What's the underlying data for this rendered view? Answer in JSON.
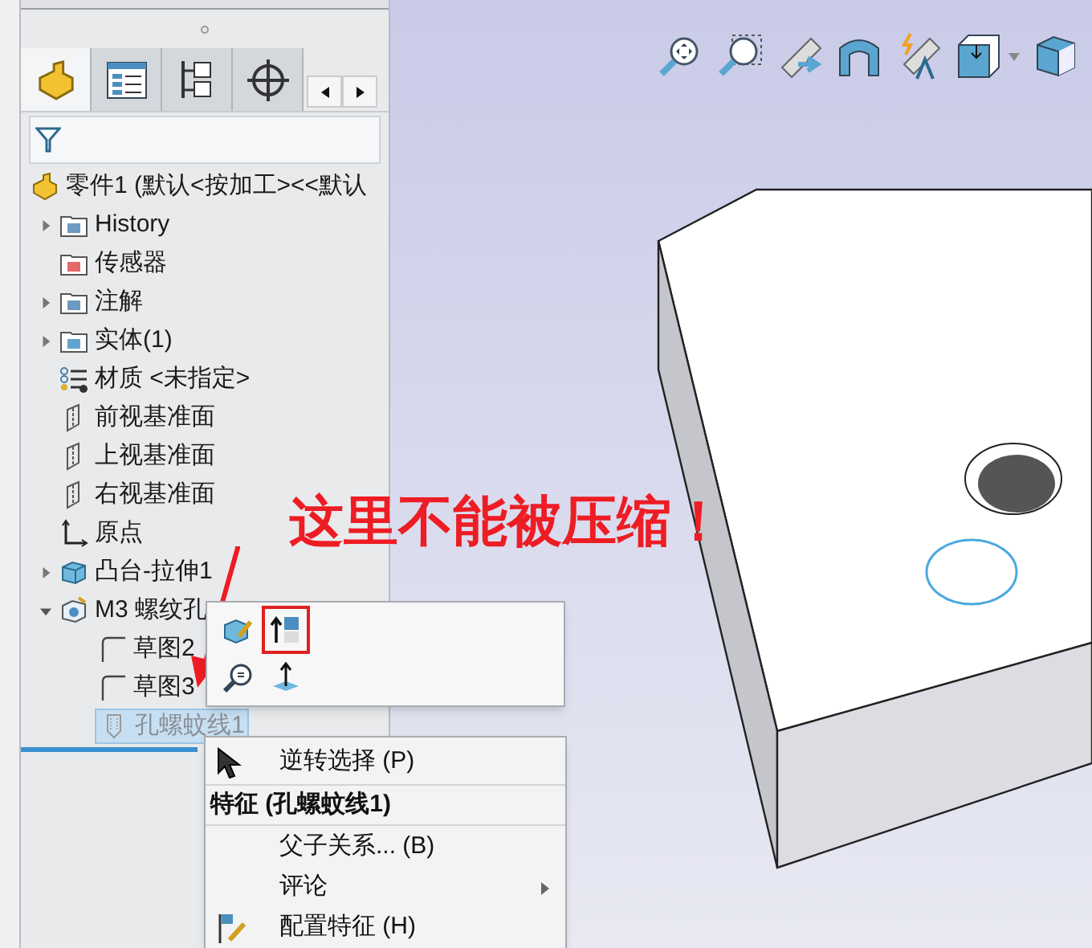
{
  "panel_tabs": [
    {
      "kind": "part",
      "selected": true
    },
    {
      "kind": "property",
      "selected": false
    },
    {
      "kind": "config",
      "selected": false
    },
    {
      "kind": "target",
      "selected": false
    }
  ],
  "tree": {
    "label": "零件1 (默认<按加工><<默认",
    "kind": "part",
    "selected": false,
    "children": [
      {
        "label": "History",
        "kind": "history",
        "expanded": false,
        "selected": false
      },
      {
        "label": "传感器",
        "kind": "sensor",
        "selected": false
      },
      {
        "label": "注解",
        "kind": "annotation",
        "expanded": false,
        "selected": false
      },
      {
        "label": "实体(1)",
        "kind": "solid",
        "expanded": false,
        "selected": false
      },
      {
        "label": "材质 <未指定>",
        "kind": "material",
        "selected": false
      },
      {
        "label": "前视基准面",
        "kind": "plane",
        "selected": false
      },
      {
        "label": "上视基准面",
        "kind": "plane",
        "selected": false
      },
      {
        "label": "右视基准面",
        "kind": "plane",
        "selected": false
      },
      {
        "label": "原点",
        "kind": "origin",
        "selected": false
      },
      {
        "label": "凸台-拉伸1",
        "kind": "extrude",
        "expanded": false,
        "selected": false
      },
      {
        "label": "M3 螺纹孔",
        "kind": "hole",
        "expanded": true,
        "selected": false,
        "children": [
          {
            "label": "草图2",
            "kind": "sketch",
            "selected": false
          },
          {
            "label": "草图3",
            "kind": "sketch",
            "selected": false
          },
          {
            "label": "孔螺蚊线1",
            "kind": "thread",
            "selected": true
          }
        ]
      }
    ]
  },
  "mini_toolbar": [
    {
      "kind": "edit",
      "highlighted": false
    },
    {
      "kind": "suppress",
      "highlighted": true
    },
    {
      "kind": "zoom",
      "highlighted": false
    },
    {
      "kind": "normal",
      "highlighted": false
    }
  ],
  "context_menu": [
    {
      "kind": "select",
      "label": "逆转选择 (P)",
      "submenu": false
    },
    {
      "kind": "header",
      "label": "特征 (孔螺蚊线1)"
    },
    {
      "kind": "plain",
      "label": "父子关系... (B)",
      "submenu": false
    },
    {
      "kind": "plain",
      "label": "评论",
      "submenu": true
    },
    {
      "kind": "configure",
      "label": "配置特征 (H)",
      "submenu": false
    }
  ],
  "annotation": {
    "text": "这里不能被压缩！"
  }
}
